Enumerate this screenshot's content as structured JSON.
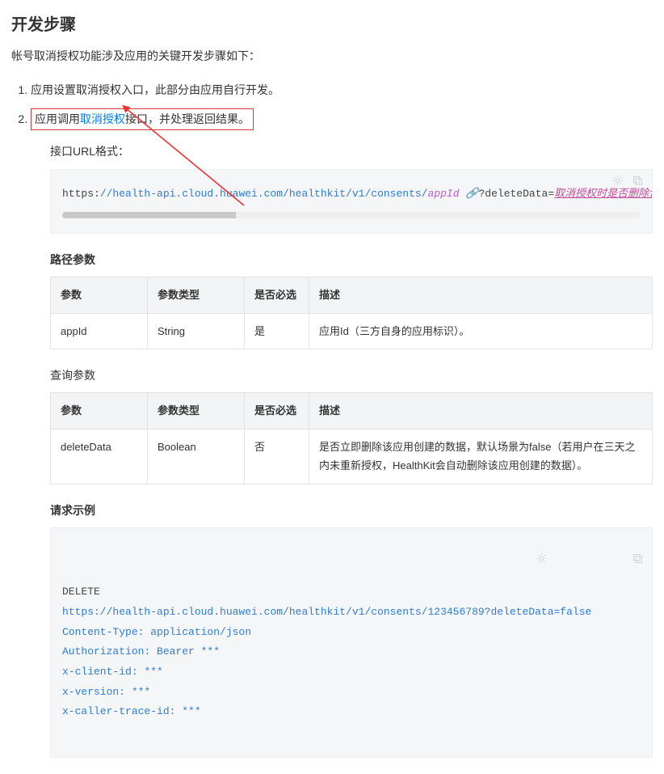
{
  "heading": "开发步骤",
  "intro": "帐号取消授权功能涉及应用的关键开发步骤如下：",
  "steps": {
    "s1": "应用设置取消授权入口，此部分由应用自行开发。",
    "s2_pre": "应用调用",
    "s2_link": "取消授权",
    "s2_post": "接口，并处理返回结果。"
  },
  "url_label": "接口URL格式：",
  "url_code": {
    "scheme": "https:",
    "rest": "//health-api.cloud.huawei.com/healthkit/v1/consents/",
    "param": "appId",
    "query": "?deleteData=",
    "desc": "取消授权时是否删除该应用创建"
  },
  "path_params_title": "路径参数",
  "table_headers": {
    "p": "参数",
    "t": "参数类型",
    "r": "是否必选",
    "d": "描述"
  },
  "path_rows": [
    {
      "p": "appId",
      "t": "String",
      "r": "是",
      "d": "应用Id（三方自身的应用标识）。"
    }
  ],
  "query_params_title": "查询参数",
  "query_rows": [
    {
      "p": "deleteData",
      "t": "Boolean",
      "r": "否",
      "d": "是否立即删除该应用创建的数据，默认场景为false（若用户在三天之内未重新授权，HealthKit会自动删除该应用创建的数据）。"
    }
  ],
  "request_example_title": "请求示例",
  "request_example": {
    "method": "DELETE",
    "url": "https://health-api.cloud.huawei.com/healthkit/v1/consents/123456789?deleteData=false",
    "h1": "Content-Type: application/json",
    "h2": "Authorization: Bearer ***",
    "h3": "x-client-id: ***",
    "h4": "x-version: ***",
    "h5": "x-caller-trace-id: ***"
  }
}
